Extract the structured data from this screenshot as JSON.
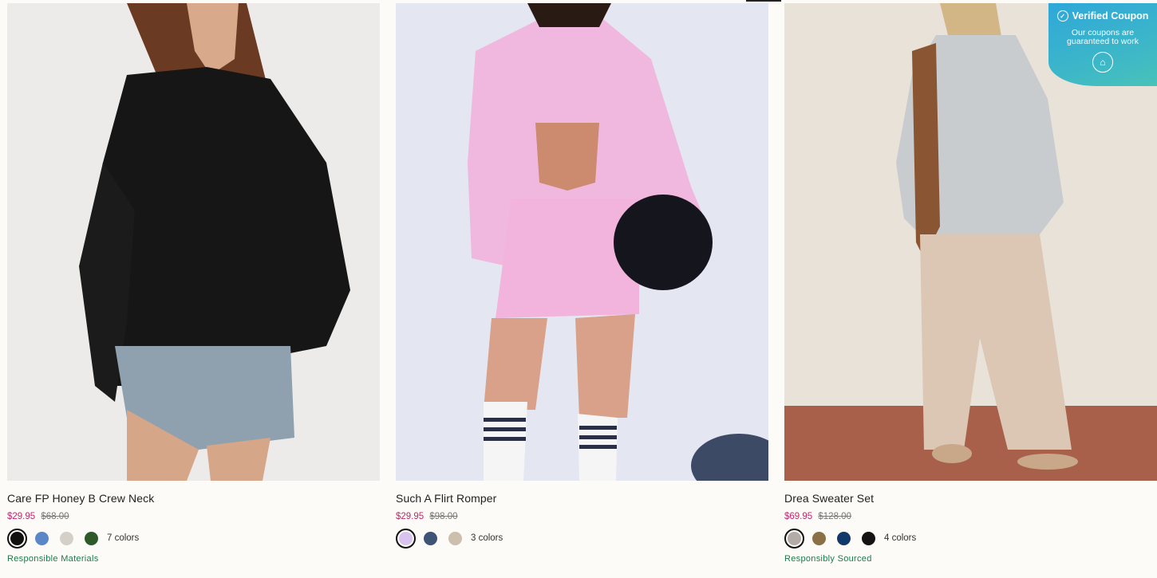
{
  "products": [
    {
      "title": "Care FP Honey B Crew Neck",
      "price_sale": "$29.95",
      "price_original": "$68.00",
      "swatch_colors": [
        "#111111",
        "#5b87c9",
        "#d4cfc7",
        "#2e5a2a"
      ],
      "selected_swatch": 0,
      "colors_count": "7 colors",
      "tag": "Responsible Materials"
    },
    {
      "title": "Such A Flirt Romper",
      "price_sale": "$29.95",
      "price_original": "$98.00",
      "swatch_colors": [
        "#d9c4ef",
        "#3e5378",
        "#cdbfae"
      ],
      "selected_swatch": 0,
      "colors_count": "3 colors",
      "tag": ""
    },
    {
      "title": "Drea Sweater Set",
      "price_sale": "$69.95",
      "price_original": "$128.00",
      "swatch_colors": [
        "#b3aba6",
        "#8a7045",
        "#11386a",
        "#131313"
      ],
      "selected_swatch": 0,
      "colors_count": "4 colors",
      "tag": "Responsibly Sourced"
    }
  ],
  "coupon": {
    "title": "Verified Coupon",
    "subtitle_line1": "Our coupons are",
    "subtitle_line2": "guaranteed to work"
  },
  "colors": {
    "sale_price": "#c2266b",
    "tag_green": "#1d7a4a"
  }
}
